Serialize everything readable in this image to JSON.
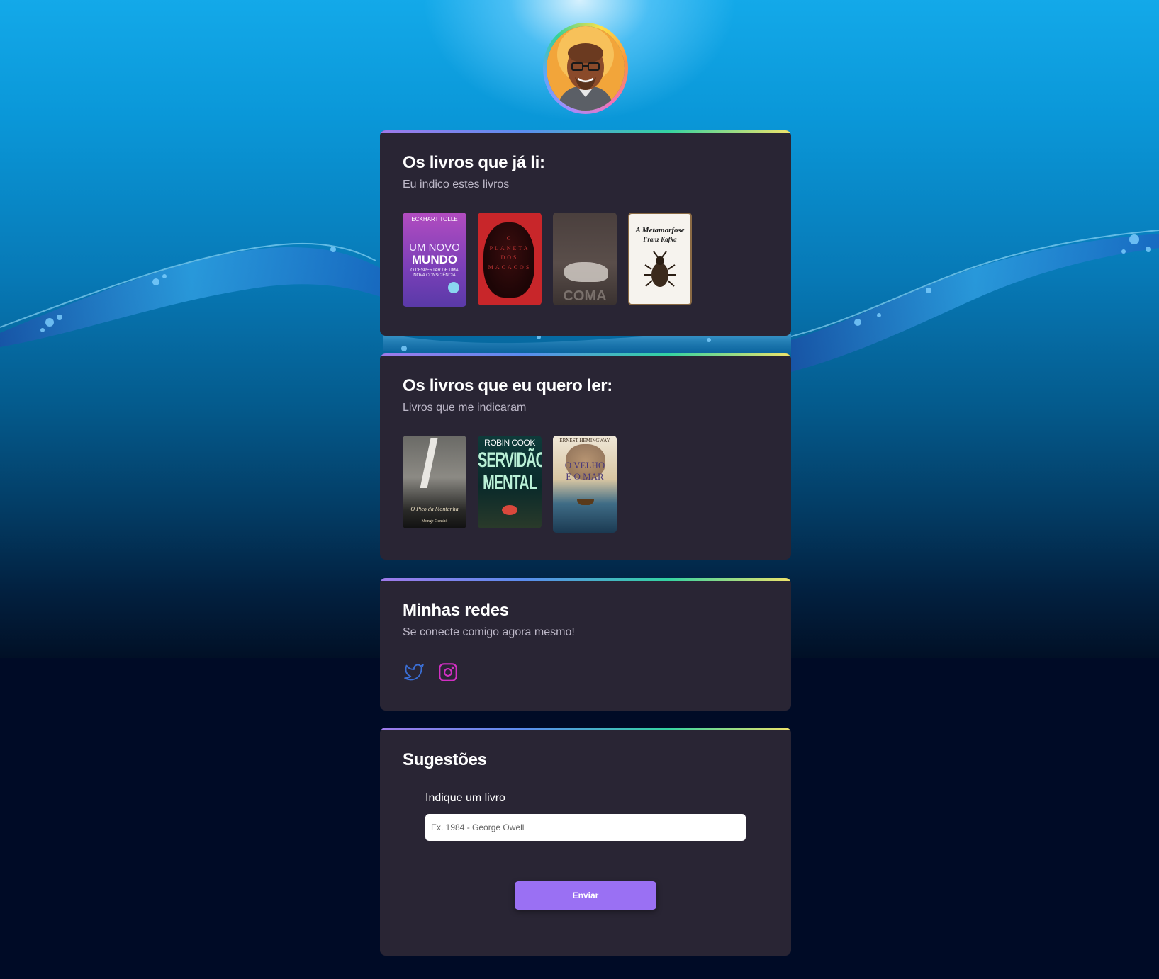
{
  "profile": {
    "avatar_icon": "profile-portrait"
  },
  "read_section": {
    "title": "Os livros que já li:",
    "subtitle": "Eu indico estes livros",
    "books": [
      {
        "author": "ECKHART TOLLE",
        "title_a": "UM NOVO",
        "title_b": "MUNDO",
        "tagline": "O DESPERTAR DE UMA NOVA CONSCIÊNCIA"
      },
      {
        "title": "O PLANETA DOS MACACOS"
      },
      {
        "title": "COMA"
      },
      {
        "title": "A Metamorfose",
        "author": "Franz Kafka"
      }
    ]
  },
  "want_section": {
    "title": "Os livros que eu quero ler:",
    "subtitle": "Livros que me indicaram",
    "books": [
      {
        "title": "O Pico da Montanha",
        "author": "Monge Genshö"
      },
      {
        "author": "ROBIN COOK",
        "title_a": "SERVIDÃO",
        "title_b": "MENTAL"
      },
      {
        "author": "ERNEST HEMINGWAY",
        "title_a": "O VELHO",
        "title_b": "E O MAR"
      }
    ]
  },
  "social_section": {
    "title": "Minhas redes",
    "subtitle": "Se conecte comigo agora mesmo!",
    "links": [
      {
        "icon": "twitter-icon",
        "color": "#3b6fd6"
      },
      {
        "icon": "instagram-icon",
        "color": "#d22fc3"
      }
    ]
  },
  "suggest_section": {
    "title": "Sugestões",
    "label": "Indique um livro",
    "placeholder": "Ex. 1984 - George Owell",
    "button": "Enviar",
    "button_color": "#9a70f3"
  }
}
